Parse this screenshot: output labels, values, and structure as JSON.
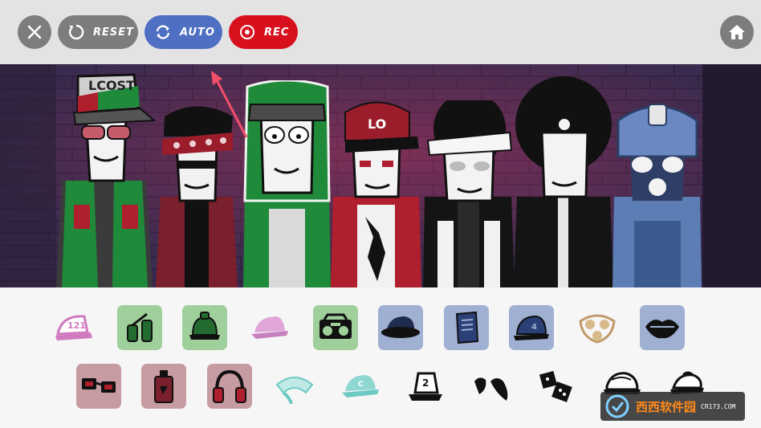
{
  "toolbar": {
    "close_icon": "close-icon",
    "reset_label": "RESET",
    "auto_label": "AUTO",
    "rec_label": "REC",
    "home_icon": "home-icon",
    "colors": {
      "reset": "#7d7d7d",
      "auto": "#4e6fc2",
      "rec": "#d8101e",
      "bar": "#e3e3e3"
    }
  },
  "stage": {
    "cap_text_1": "LCOST",
    "cap_text_2": "LO"
  },
  "tray": {
    "row1": [
      {
        "icon": "pink-cap-121-icon",
        "badge": "121",
        "bg": "plain"
      },
      {
        "icon": "green-backpack-icon",
        "bg": "green"
      },
      {
        "icon": "green-helmet-icon",
        "bg": "green"
      },
      {
        "icon": "pink-cap-icon",
        "bg": "plain"
      },
      {
        "icon": "boombox-icon",
        "bg": "green"
      },
      {
        "icon": "navy-hat-icon",
        "bg": "blue"
      },
      {
        "icon": "notebook-icon",
        "bg": "blue"
      },
      {
        "icon": "blue-cap-icon",
        "bg": "blue"
      },
      {
        "icon": "gas-mask-icon",
        "bg": "plain"
      },
      {
        "icon": "lips-icon",
        "bg": "blue"
      }
    ],
    "row2": [
      {
        "icon": "red-glasses-icon",
        "bg": "red"
      },
      {
        "icon": "spray-can-icon",
        "bg": "red"
      },
      {
        "icon": "headphones-icon",
        "bg": "red"
      },
      {
        "icon": "teal-scarf-icon",
        "bg": "plain"
      },
      {
        "icon": "teal-cap-icon",
        "bg": "plain"
      },
      {
        "icon": "bucket-hat-icon",
        "bg": "plain"
      },
      {
        "icon": "tadpole-icon",
        "bg": "plain"
      },
      {
        "icon": "dice-icon",
        "bg": "plain"
      },
      {
        "icon": "swirl-hat-icon",
        "bg": "plain"
      },
      {
        "icon": "curl-hat-icon",
        "bg": "plain"
      }
    ]
  },
  "watermark": {
    "text": "西西软件园",
    "sub": "CR173.COM"
  }
}
